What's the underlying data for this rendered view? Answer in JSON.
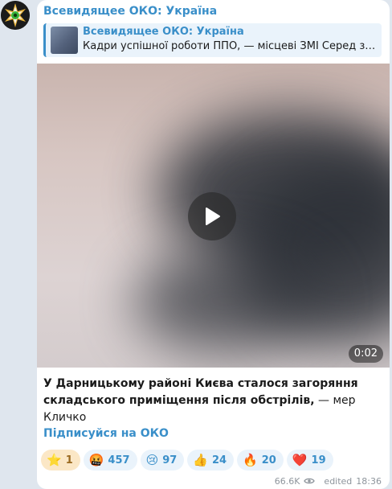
{
  "channel": {
    "name": "Всевидящее ОКО: Україна"
  },
  "reply": {
    "title": "Всевидящее ОКО: Україна",
    "text": "Кадри успішної роботи ППО, — місцеві ЗМІ Серед зни…"
  },
  "video": {
    "duration": "0:02"
  },
  "caption": {
    "bold": "У Дарницькому районі Києва сталося загоряння складського приміщення після обстрілів,",
    "rest": " — мер Кличко"
  },
  "link": {
    "label": "Підписуйся на ОКО"
  },
  "reactions": [
    {
      "emoji": "⭐",
      "count": "1",
      "own": true
    },
    {
      "emoji": "🤬",
      "count": "457"
    },
    {
      "emoji": "😢",
      "count": "97"
    },
    {
      "emoji": "👍",
      "count": "24"
    },
    {
      "emoji": "🔥",
      "count": "20"
    },
    {
      "emoji": "❤️",
      "count": "19"
    }
  ],
  "meta": {
    "views": "66.6K",
    "edited": "edited",
    "time": "18:36"
  },
  "colors": {
    "accent": "#3a8fc9",
    "bubble": "#ffffff",
    "background": "#dfe6ee"
  }
}
